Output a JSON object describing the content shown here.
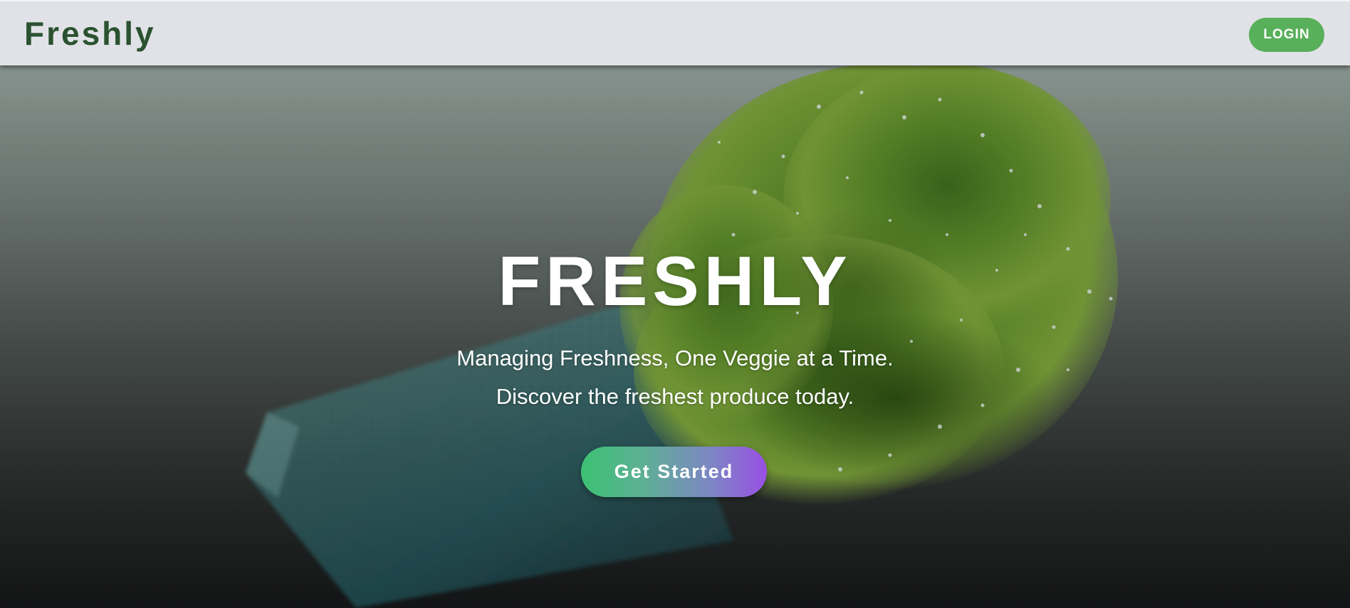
{
  "header": {
    "brand": "Freshly",
    "login_label": "LOGIN"
  },
  "hero": {
    "title": "FRESHLY",
    "tagline_1": "Managing Freshness, One Veggie at a Time.",
    "tagline_2": "Discover the freshest produce today.",
    "cta_label": "Get Started"
  },
  "colors": {
    "brand_text": "#2a5230",
    "login_button": "#58b05a",
    "header_bg": "#e1e2e7",
    "cta_gradient_start": "#3cc272",
    "cta_gradient_end": "#9a4fe4"
  }
}
